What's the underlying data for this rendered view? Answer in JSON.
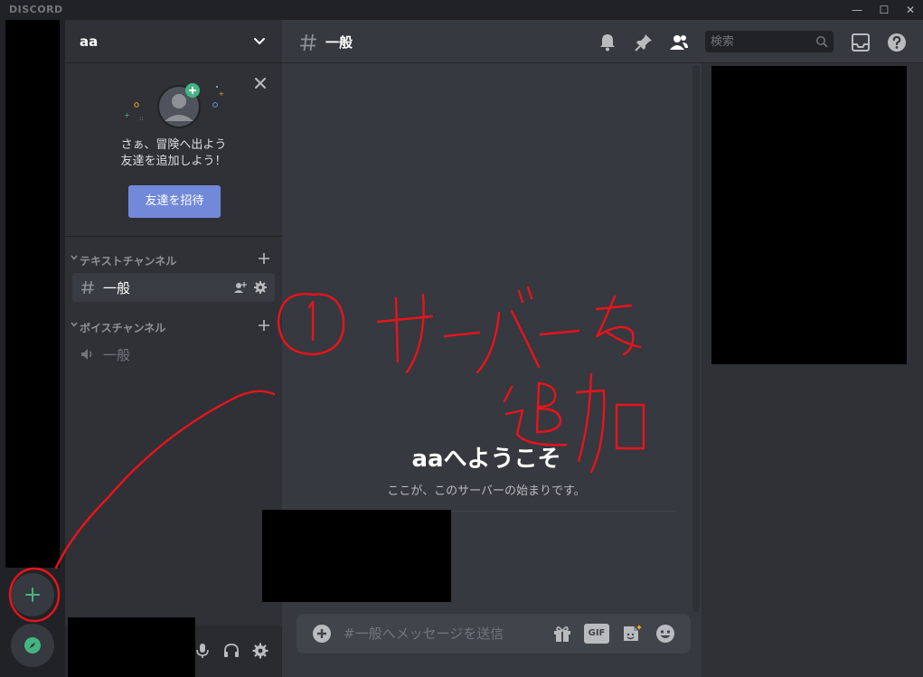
{
  "window": {
    "brand": "DISCORD",
    "controls": {
      "minimize": "—",
      "maximize": "☐",
      "close": "✕"
    }
  },
  "server_rail": {
    "add_server_icon": "plus-icon",
    "explore_icon": "compass-icon"
  },
  "sidebar": {
    "guild_name": "aa",
    "invite": {
      "text_line1": "さぁ、冒険へ出よう",
      "text_line2": "友達を追加しよう！",
      "button": "友達を招待"
    },
    "categories": [
      {
        "label": "テキストチャンネル"
      },
      {
        "label": "ボイスチャンネル"
      }
    ],
    "channels": {
      "text": {
        "name": "一般"
      },
      "voice": {
        "name": "一般"
      }
    }
  },
  "chat": {
    "channel_name": "一般",
    "search_placeholder": "検索",
    "welcome_title": "aaへようこそ",
    "welcome_subtitle": "ここが、このサーバーの始まりです。",
    "composer_placeholder": "#一般へメッセージを送信",
    "gif_label": "GIF"
  },
  "annotation": {
    "color": "#e8141b"
  }
}
